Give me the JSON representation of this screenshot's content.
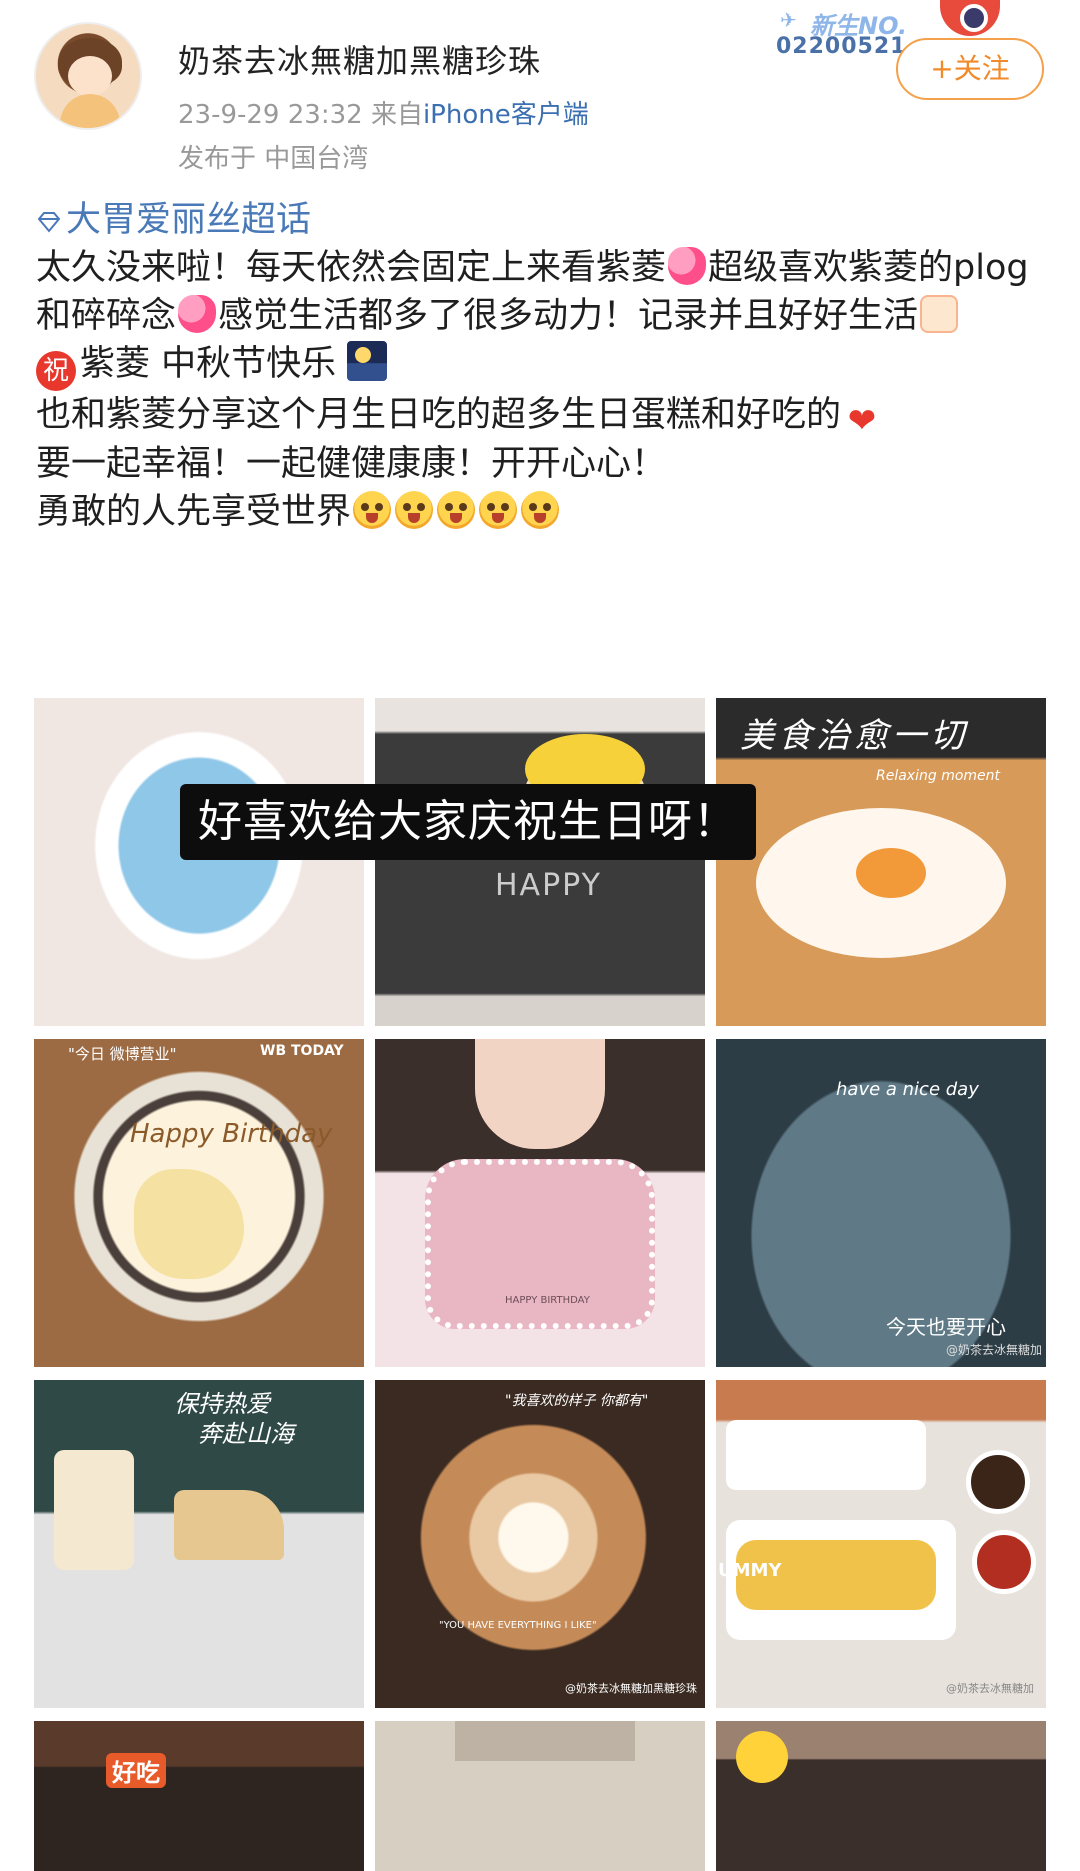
{
  "header": {
    "username": "奶茶去冰無糖加黑糖珍珠",
    "time": "23-9-29 23:32",
    "source_prefix": "来自",
    "client": "iPhone客户端",
    "location": "发布于 中国台湾",
    "follow_label": "+关注",
    "badge_title": "新生NO.",
    "badge_number": "02200521"
  },
  "post": {
    "topic": "大胃爱丽丝超话",
    "line1": "太久没来啦！每天依然会固定上来看紫菱",
    "line1b": "超级喜欢紫菱的plog和碎碎念",
    "line1c": "感觉生活都多了很多动力！记录并且好好生活",
    "line2_zhu": "祝",
    "line2": "紫菱 中秋节快乐",
    "line3": "也和紫菱分享这个月生日吃的超多生日蛋糕和好吃的",
    "line4": "要一起幸福！一起健健康康！开开心心！",
    "line5": "勇敢的人先享受世界"
  },
  "images": {
    "img3_caption": "美食治愈一切",
    "img3_sub": "Relaxing moment",
    "img4_caption": "\"今日 微博营业\"",
    "img4_wb": "WB TODAY",
    "img4_icing": "Happy Birthday",
    "img2_word": "HAPPY",
    "img5_caption": "HAPPY BIRTHDAY",
    "img6_caption": "have a nice day",
    "img6_caption2": "今天也要开心",
    "img6_wm": "@奶茶去冰無糖加",
    "img7_caption": "保持热爱",
    "img7_caption2": "奔赴山海",
    "img8_caption": "\"我喜欢的样子 你都有\"",
    "img8_caption2": "\"YOU HAVE EVERYTHING I LIKE\"",
    "img8_wm": "@奶茶去冰無糖加黑糖珍珠",
    "img9_caption": "UMMY",
    "img9_wm": "@奶茶去冰無糖加",
    "img10_caption": "好吃"
  },
  "overlay_caption": "好喜欢给大家庆祝生日呀！",
  "colors": {
    "topic_link": "#4a79b8",
    "follow_border": "#f5a04a",
    "meta_gray": "#999999",
    "zhu_red": "#e8372c"
  }
}
